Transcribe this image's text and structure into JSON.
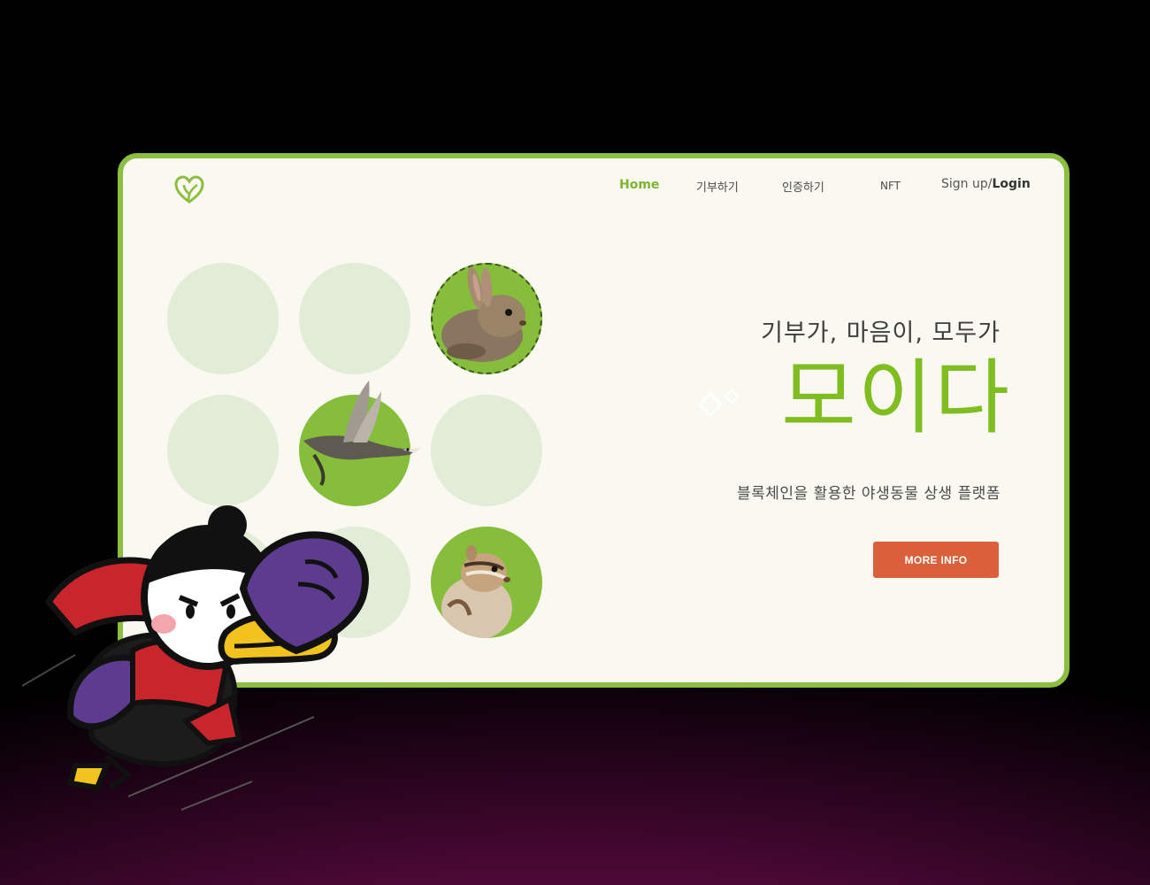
{
  "nav": {
    "home": "Home",
    "donate": "기부하기",
    "verify": "인증하기",
    "nft": "NFT",
    "signup": "Sign up/",
    "login": "Login"
  },
  "hero": {
    "tagline": "기부가, 마음이, 모두가",
    "brand": "모이다",
    "subtitle": "블록체인을 활용한 야생동물 상생 플랫폼",
    "cta": "MORE INFO"
  },
  "colors": {
    "accent_green": "#8cbf3f",
    "brand_green": "#7fbd20",
    "light_circle": "#e3ecd6",
    "button": "#d9603a",
    "background": "#f9f8f1"
  },
  "icons": {
    "logo": "heart-leaf-icon",
    "sparkle": "diamond-sparkle-icon"
  }
}
